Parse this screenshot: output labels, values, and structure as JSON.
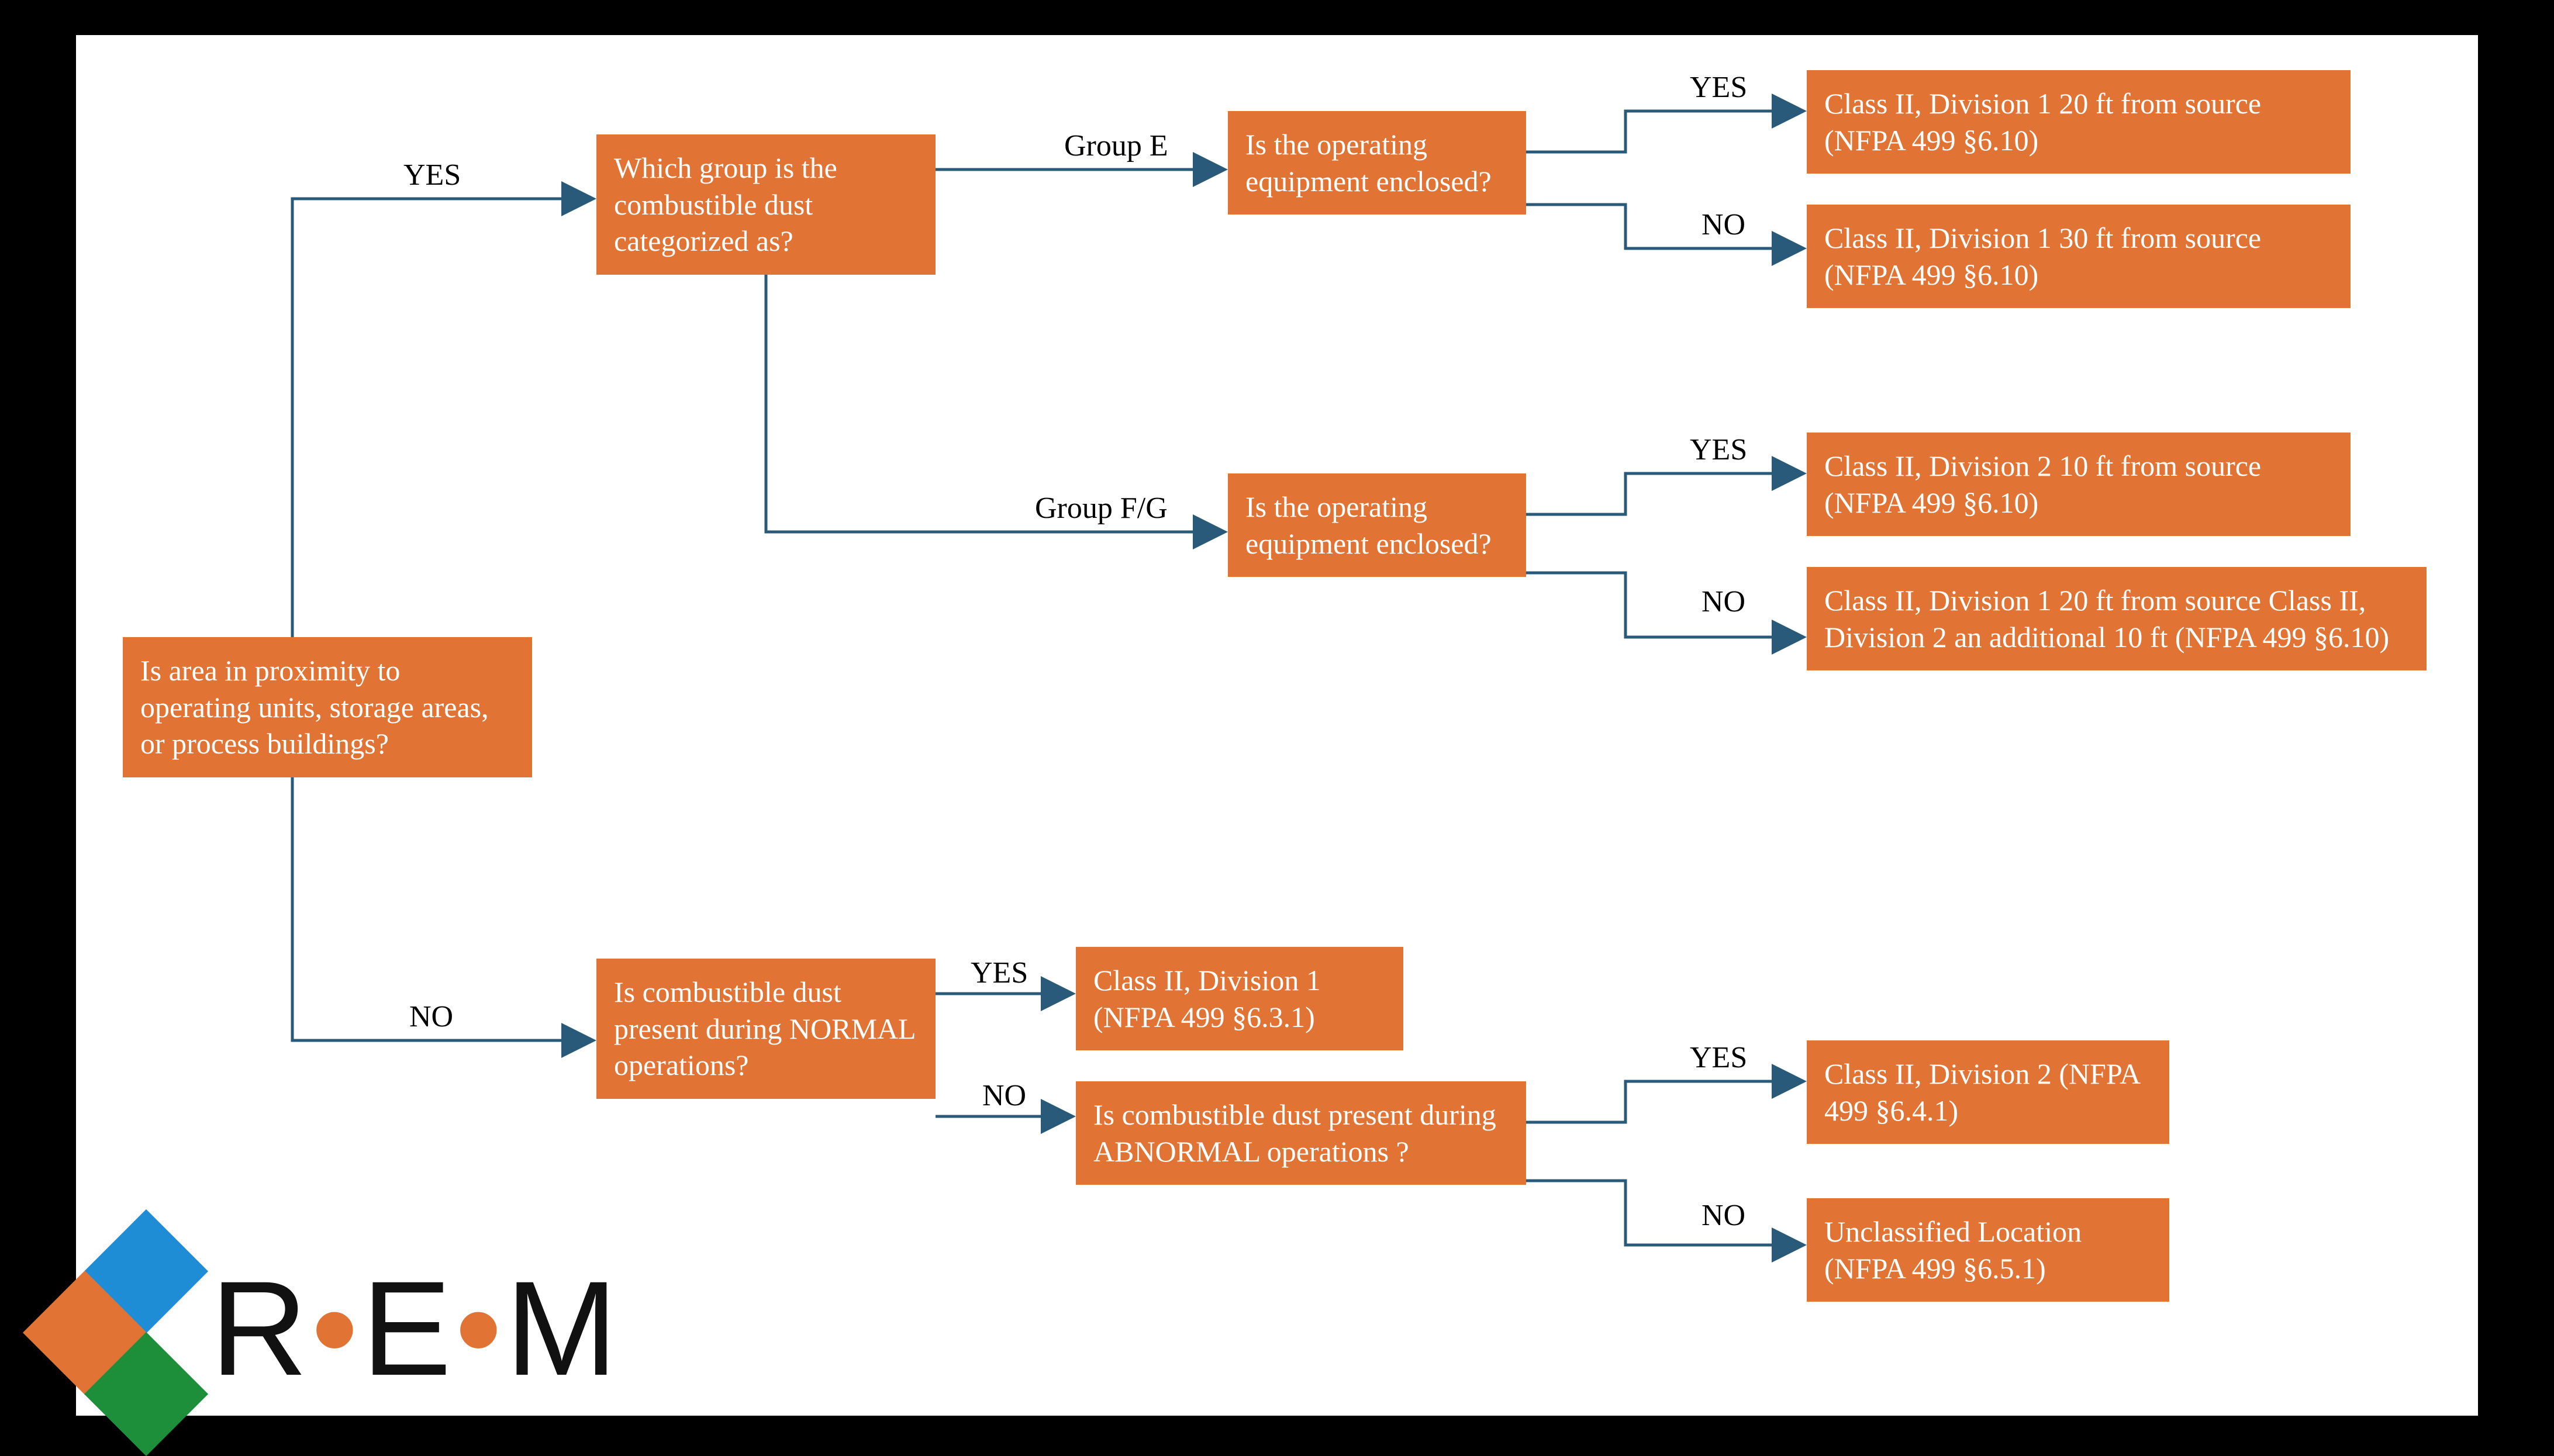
{
  "nodes": {
    "q_root": "Is area in proximity to operating units, storage areas, or process buildings?",
    "q_group": "Which group is the combustible dust categorized as?",
    "q_enclosed_e": "Is the operating equipment enclosed?",
    "q_enclosed_fg": "Is the operating equipment enclosed?",
    "r_e_yes": "Class II, Division 1 20 ft from source (NFPA 499 §6.10)",
    "r_e_no": "Class II, Division 1 30 ft from source (NFPA 499 §6.10)",
    "r_fg_yes": "Class II, Division 2 10 ft from source (NFPA 499 §6.10)",
    "r_fg_no": "Class II, Division 1 20 ft from source Class II, Division 2 an additional 10 ft (NFPA 499 §6.10)",
    "q_normal": "Is combustible dust present during NORMAL operations?",
    "r_normal_yes": "Class II, Division 1 (NFPA 499 §6.3.1)",
    "q_abnormal": "Is combustible dust present during ABNORMAL operations ?",
    "r_abnormal_yes": "Class II, Division 2 (NFPA 499 §6.4.1)",
    "r_abnormal_no": "Unclassified Location (NFPA 499 §6.5.1)"
  },
  "labels": {
    "yes": "YES",
    "no": "NO",
    "group_e": "Group E",
    "group_fg": "Group F/G"
  },
  "logo": {
    "r": "R",
    "dot": "•",
    "e": "E",
    "m": "M"
  }
}
